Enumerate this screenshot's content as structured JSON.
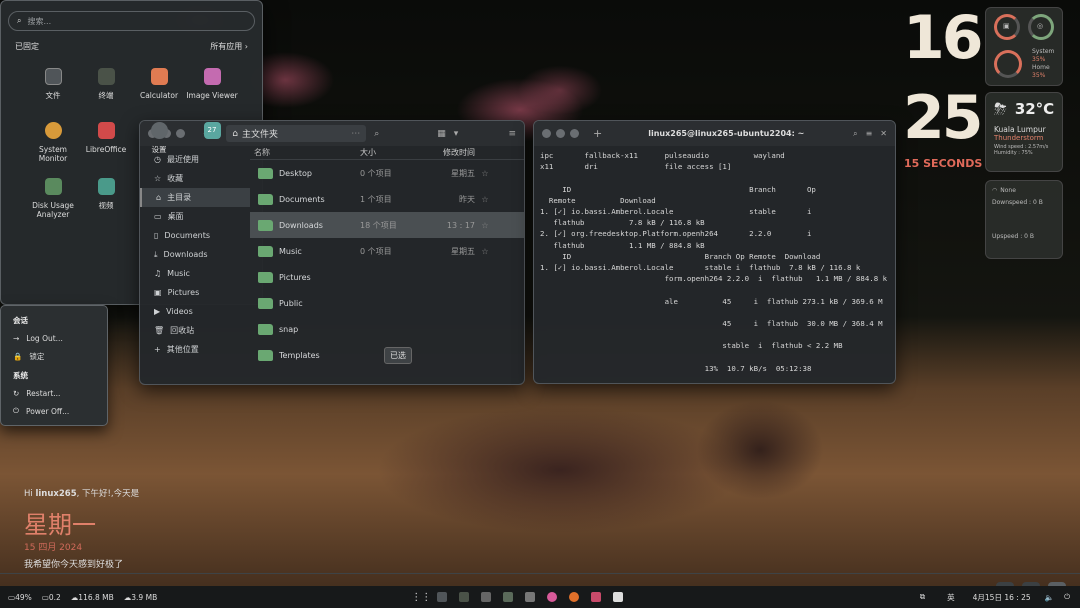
{
  "file_manager": {
    "title": "主文件夹",
    "sidebar": [
      "最近使用",
      "收藏",
      "主目录",
      "桌面",
      "Documents",
      "Downloads",
      "Music",
      "Pictures",
      "Videos",
      "回收站",
      "其他位置"
    ],
    "columns": {
      "name": "名称",
      "size": "大小",
      "modified": "修改时间"
    },
    "rows": [
      {
        "name": "Desktop",
        "size": "0 个项目",
        "date": "星期五"
      },
      {
        "name": "Documents",
        "size": "1 个项目",
        "date": "昨天"
      },
      {
        "name": "Downloads",
        "size": "18 个项目",
        "date": "13 : 17"
      },
      {
        "name": "Music",
        "size": "0 个项目",
        "date": "星期五"
      },
      {
        "name": "Pictures",
        "size": "",
        "date": ""
      },
      {
        "name": "Public",
        "size": "",
        "date": ""
      },
      {
        "name": "snap",
        "size": "",
        "date": ""
      },
      {
        "name": "Templates",
        "size": "",
        "date": ""
      }
    ],
    "tooltip": "已选"
  },
  "terminal": {
    "title": "linux265@linux265-ubuntu2204: ~",
    "lines": [
      "ipc       fallback-x11      pulseaudio          wayland",
      "x11       dri               file access [1]",
      "",
      "     ID                                        Branch       Op",
      "  Remote          Download",
      "1. [✓] io.bassi.Amberol.Locale                 stable       i",
      "   flathub          7.8 kB / 116.8 kB",
      "2. [✓] org.freedesktop.Platform.openh264       2.2.0        i",
      "   flathub          1.1 MB / 884.8 kB",
      "     ID                              Branch Op Remote  Download",
      "1. [✓] io.bassi.Amberol.Locale       stable i  flathub  7.8 kB / 116.8 k",
      "                            form.openh264 2.2.0  i  flathub   1.1 MB / 884.8 k",
      "",
      "                            ale          45     i  flathub 273.1 kB / 369.6 M",
      "",
      "                                         45     i  flathub  30.0 MB / 368.4 M",
      "",
      "                                         stable  i  flathub < 2.2 MB",
      "",
      "                                     13%  10.7 kB/s  05:12:38"
    ]
  },
  "launcher": {
    "search_placeholder": "搜索...",
    "pinned": "已固定",
    "all_apps": "所有应用",
    "apps": [
      {
        "label": "文件",
        "color": "#505559"
      },
      {
        "label": "终端",
        "color": "#4a5248"
      },
      {
        "label": "Calculator",
        "color": "#e07b52"
      },
      {
        "label": "Image Viewer",
        "color": "#c46bb0"
      },
      {
        "label": "System Monitor",
        "color": "#d89a3a"
      },
      {
        "label": "LibreOffice",
        "color": "#d24a4a"
      },
      {
        "label": "设置",
        "color": "#60666a"
      },
      {
        "label": "27",
        "color": "#5aa7a0"
      },
      {
        "label": "Disk Usage Analyzer",
        "color": "#5a8a5e"
      },
      {
        "label": "视频",
        "color": "#4a9a8a"
      }
    ],
    "user": "linux265"
  },
  "session": {
    "session_header": "会话",
    "logout": "Log Out...",
    "lock": "锁定",
    "system_header": "系统",
    "restart": "Restart...",
    "poweroff": "Power Off..."
  },
  "clock": {
    "hour": "16",
    "minute": "25",
    "seconds": "15 SECONDS"
  },
  "sysmon": {
    "system_label": "System",
    "system_val": "35%",
    "home_label": "Home",
    "home_val": "35%"
  },
  "weather": {
    "temp": "32°C",
    "city": "Kuala Lumpur",
    "condition": "Thunderstorm",
    "wind": "Wind speed : 2.57m/s",
    "humidity": "Humidity : 75%"
  },
  "network": {
    "title": "None",
    "down": "Downspeed : 0 B",
    "up": "Upspeed : 0 B"
  },
  "greeting": {
    "line1_pre": "Hi ",
    "user": "linux265",
    "line1_post": ", 下午好!,今天是",
    "weekday": "星期一",
    "date": "15 四月 2024",
    "wish": "我希望你今天感到好极了"
  },
  "taskbar": {
    "cpu": "49%",
    "load": "0.2",
    "down": "116.8 MB",
    "up": "3.9 MB",
    "ime": "英",
    "datetime": "4月15日  16 : 25"
  },
  "colors": {
    "accent": "#d8705a",
    "folder": "#6aa872"
  }
}
